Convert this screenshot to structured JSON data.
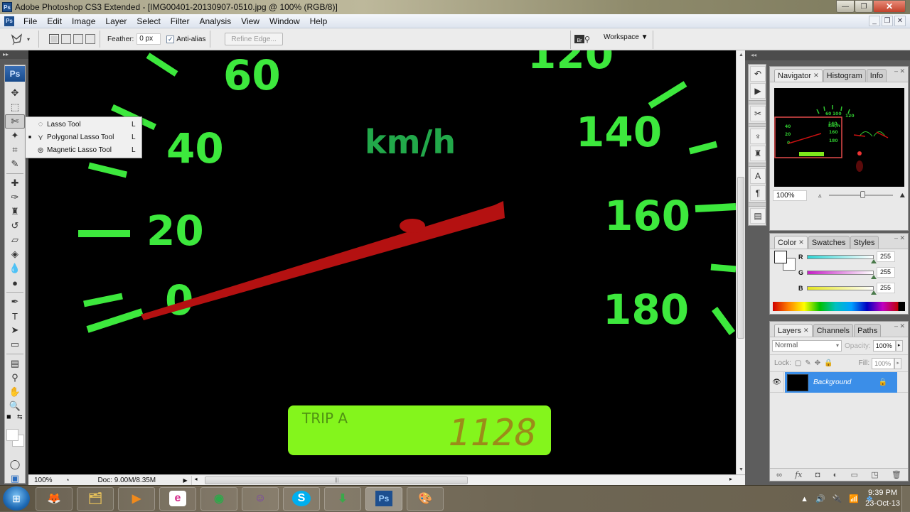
{
  "window": {
    "app_icon": "ps-icon",
    "title": "Adobe Photoshop CS3 Extended - [IMG00401-20130907-0510.jpg @ 100% (RGB/8)]",
    "controls": {
      "minimize": "—",
      "restore": "❐",
      "close": "✕"
    }
  },
  "menubar": {
    "items": [
      "File",
      "Edit",
      "Image",
      "Layer",
      "Select",
      "Filter",
      "Analysis",
      "View",
      "Window",
      "Help"
    ],
    "doc_controls": {
      "minimize": "_",
      "restore": "❐",
      "close": "✕"
    }
  },
  "options": {
    "tool_icon": "polygonal-lasso-icon",
    "feather_label": "Feather:",
    "feather_value": "0 px",
    "antialias_label": "Anti-alias",
    "antialias_checked": true,
    "refine_edge_label": "Refine Edge...",
    "bridge_label": "Br",
    "workspace_label": "Workspace ▼"
  },
  "toolbox": {
    "logo": "Ps",
    "collapse": "▸▸",
    "tools": [
      {
        "name": "move-tool",
        "glyph": "✥"
      },
      {
        "name": "marquee-tool",
        "glyph": "⬚"
      },
      {
        "name": "lasso-tool",
        "glyph": "✄",
        "active": true
      },
      {
        "name": "magic-wand-tool",
        "glyph": "✦"
      },
      {
        "name": "crop-tool",
        "glyph": "⌗"
      },
      {
        "name": "slice-tool",
        "glyph": "✎"
      },
      {
        "name": "healing-brush-tool",
        "glyph": "✚"
      },
      {
        "name": "brush-tool",
        "glyph": "✑"
      },
      {
        "name": "clone-stamp-tool",
        "glyph": "♜"
      },
      {
        "name": "history-brush-tool",
        "glyph": "↺"
      },
      {
        "name": "eraser-tool",
        "glyph": "▱"
      },
      {
        "name": "paint-bucket-tool",
        "glyph": "◈"
      },
      {
        "name": "blur-tool",
        "glyph": "💧"
      },
      {
        "name": "dodge-tool",
        "glyph": "●"
      },
      {
        "name": "pen-tool",
        "glyph": "✒"
      },
      {
        "name": "type-tool",
        "glyph": "T"
      },
      {
        "name": "path-selection-tool",
        "glyph": "➤"
      },
      {
        "name": "shape-tool",
        "glyph": "▭"
      },
      {
        "name": "notes-tool",
        "glyph": "▤"
      },
      {
        "name": "eyedropper-tool",
        "glyph": "⚲"
      },
      {
        "name": "hand-tool",
        "glyph": "✋"
      },
      {
        "name": "zoom-tool",
        "glyph": "🔍"
      }
    ],
    "quick_mask": "◯",
    "screen_mode": "▣"
  },
  "flyout": {
    "items": [
      {
        "label": "Lasso Tool",
        "key": "L",
        "icon": "lasso-icon",
        "selected": false
      },
      {
        "label": "Polygonal Lasso Tool",
        "key": "L",
        "icon": "polygonal-lasso-icon",
        "selected": true
      },
      {
        "label": "Magnetic Lasso Tool",
        "key": "L",
        "icon": "magnetic-lasso-icon",
        "selected": false
      }
    ]
  },
  "canvas": {
    "subject": "Speedometer photo",
    "speed_labels": [
      "0",
      "20",
      "40",
      "60",
      "120",
      "140",
      "160",
      "180"
    ],
    "unit": "km/h",
    "odometer_label": "TRIP A",
    "odometer_value": "1128",
    "colors": {
      "dial": "#3be63b",
      "needle": "#b01010",
      "lcd": "#8aff1a"
    }
  },
  "statusbar": {
    "zoom": "100%",
    "doc_info": "Doc: 9.00M/8.35M"
  },
  "dock": {
    "collapse": "◂◂"
  },
  "navigator_panel": {
    "tabs": [
      "Navigator",
      "Histogram",
      "Info"
    ],
    "active_tab": "Navigator",
    "zoom": "100%"
  },
  "color_panel": {
    "tabs": [
      "Color",
      "Swatches",
      "Styles"
    ],
    "active_tab": "Color",
    "channels": [
      {
        "label": "R",
        "value": "255"
      },
      {
        "label": "G",
        "value": "255"
      },
      {
        "label": "B",
        "value": "255"
      }
    ],
    "foreground": "#ffffff",
    "background": "#ffffff"
  },
  "layers_panel": {
    "tabs": [
      "Layers",
      "Channels",
      "Paths"
    ],
    "active_tab": "Layers",
    "blend_mode": "Normal",
    "opacity_label": "Opacity:",
    "opacity": "100%",
    "lock_label": "Lock:",
    "fill_label": "Fill:",
    "fill": "100%",
    "layers": [
      {
        "name": "Background",
        "visible": true,
        "locked": true,
        "selected": true
      }
    ]
  },
  "taskbar": {
    "apps": [
      {
        "name": "firefox",
        "glyph": "🦊"
      },
      {
        "name": "file-explorer",
        "glyph": "🗂"
      },
      {
        "name": "media-player",
        "glyph": "▶"
      },
      {
        "name": "app-e",
        "glyph": "e"
      },
      {
        "name": "chrome",
        "glyph": "◉"
      },
      {
        "name": "yahoo-messenger",
        "glyph": "☺"
      },
      {
        "name": "skype",
        "glyph": "S"
      },
      {
        "name": "download-manager",
        "glyph": "⬇"
      },
      {
        "name": "photoshop",
        "glyph": "Ps",
        "active": true
      },
      {
        "name": "paint",
        "glyph": "🎨"
      }
    ],
    "tray": [
      "▲",
      "🔊",
      "🔌",
      "📶",
      "❖"
    ],
    "time": "9:39 PM",
    "date": "23-Oct-13"
  }
}
